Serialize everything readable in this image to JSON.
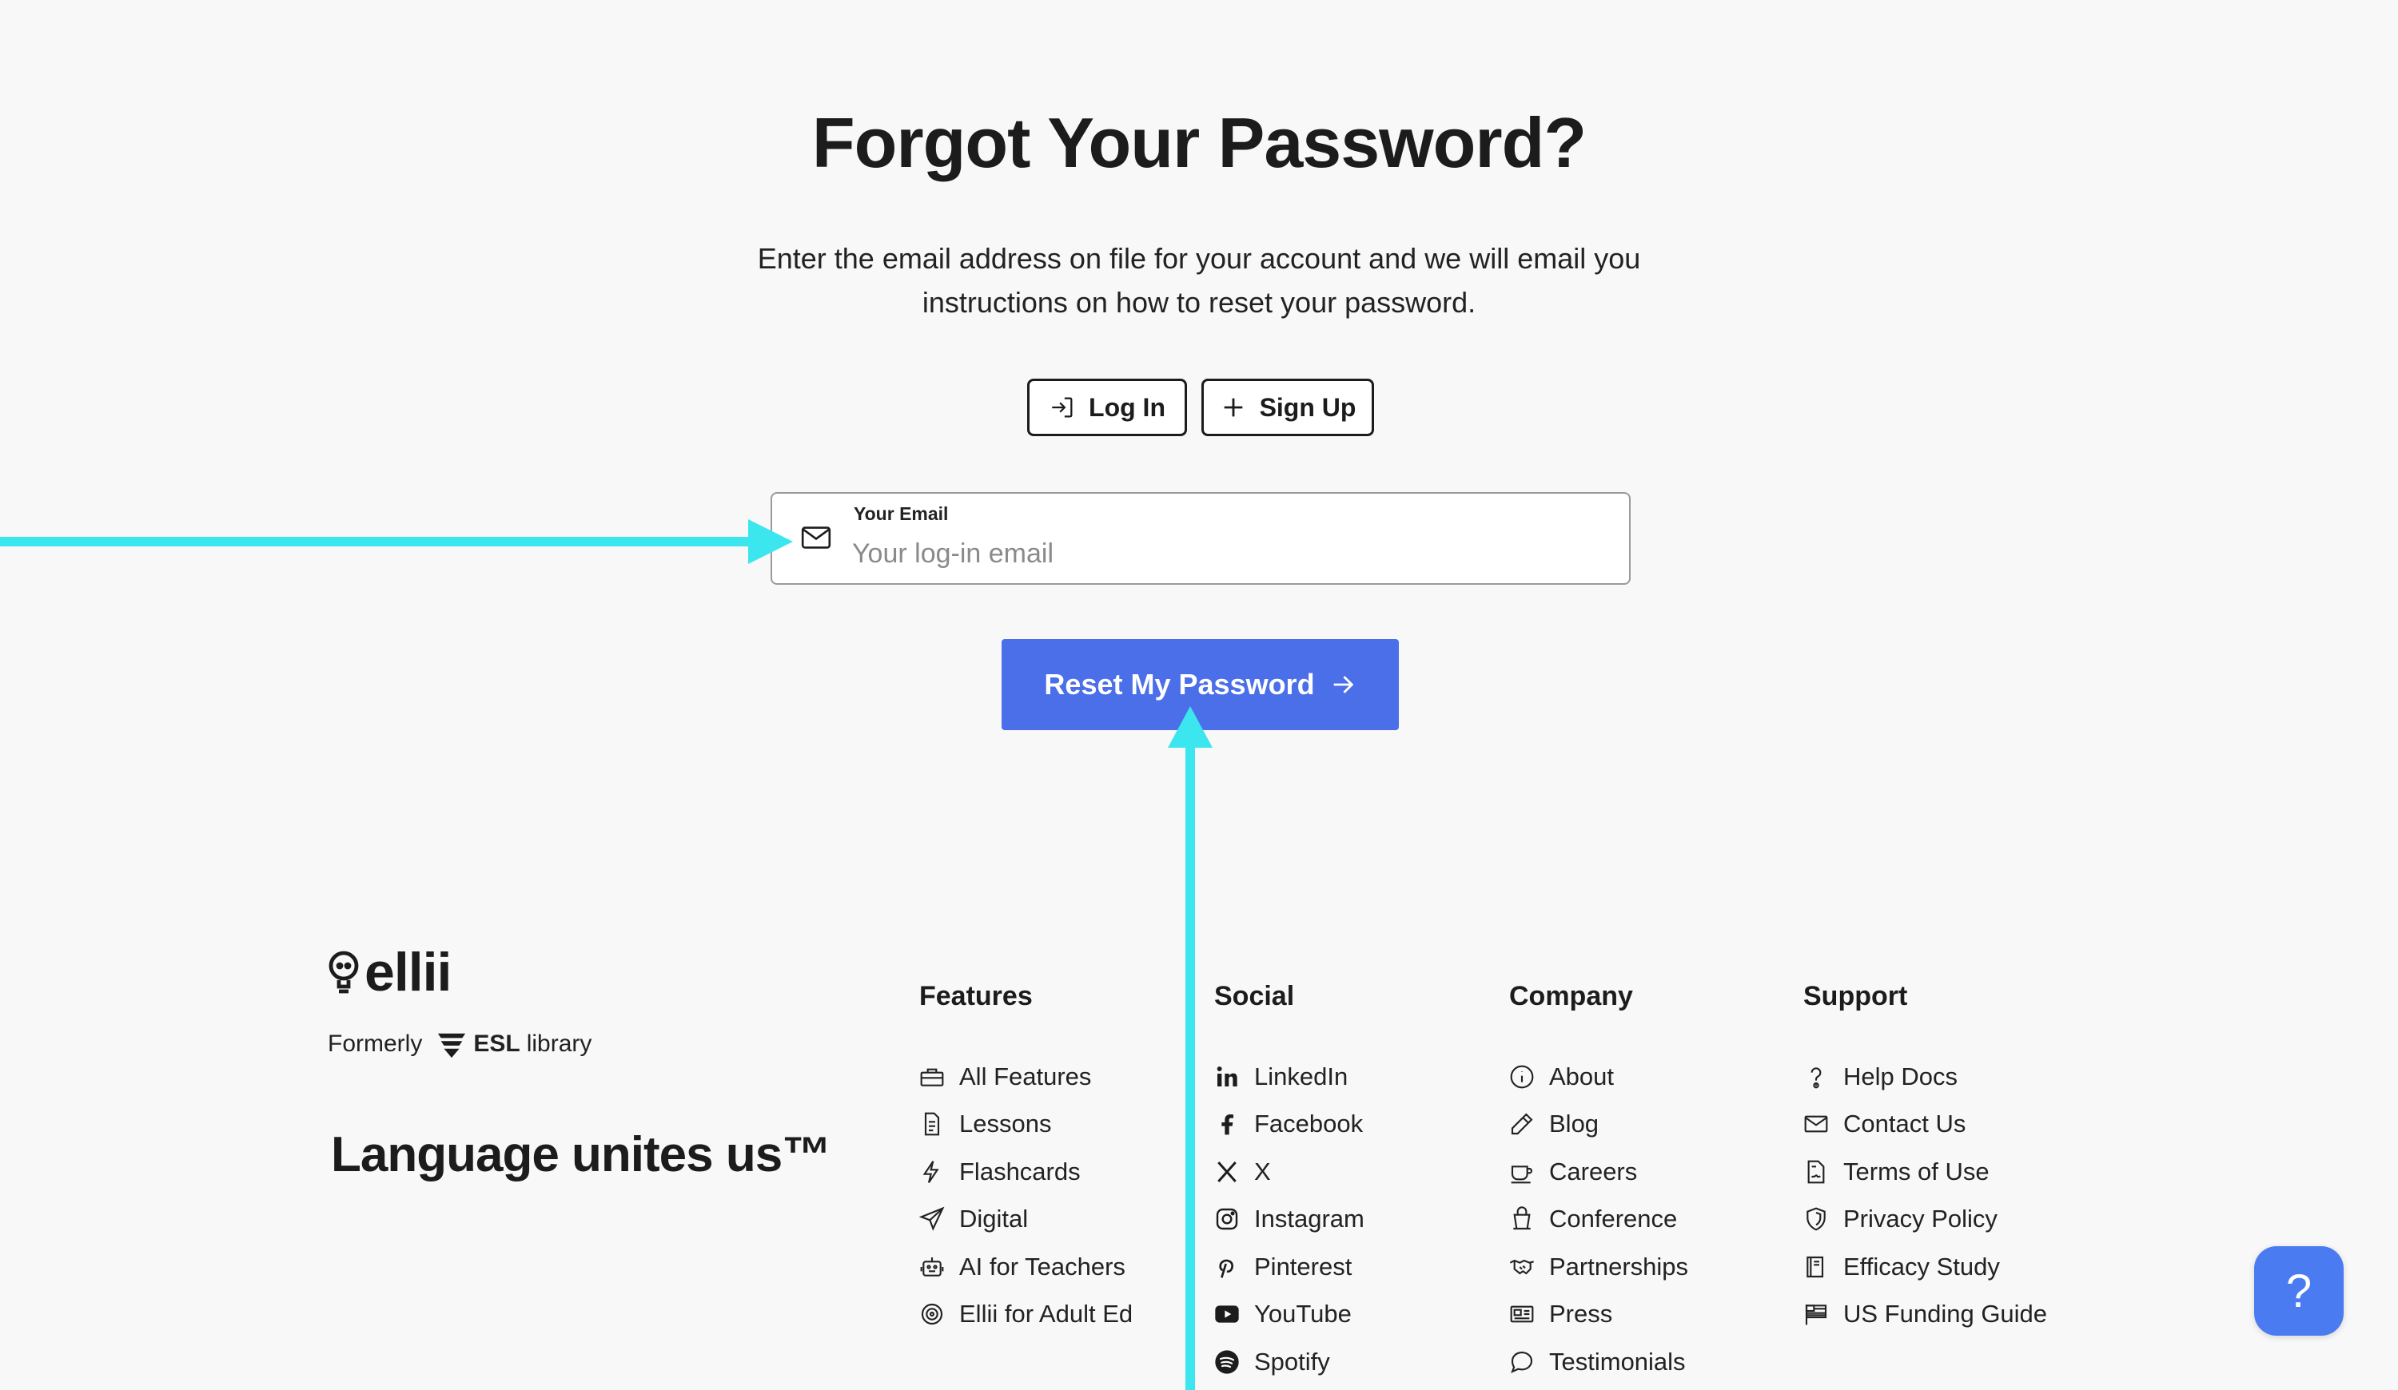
{
  "page": {
    "title": "Forgot Your Password?",
    "subtitle": "Enter the email address on file for your account and we will email you instructions on how to reset your password."
  },
  "auth_buttons": {
    "login_label": "Log In",
    "signup_label": "Sign Up"
  },
  "email_field": {
    "label": "Your Email",
    "placeholder": "Your log-in email",
    "value": ""
  },
  "reset_button": {
    "label": "Reset My Password"
  },
  "footer": {
    "brand": {
      "logo_text": "ellii",
      "formerly_label": "Formerly",
      "esl_bold": "ESL",
      "esl_light": "library",
      "tagline": "Language unites us™"
    },
    "columns": [
      {
        "heading": "Features",
        "items": [
          {
            "label": "All Features",
            "icon": "toolbox-icon"
          },
          {
            "label": "Lessons",
            "icon": "document-icon"
          },
          {
            "label": "Flashcards",
            "icon": "lightning-icon"
          },
          {
            "label": "Digital",
            "icon": "paper-plane-icon"
          },
          {
            "label": "AI for Teachers",
            "icon": "robot-icon"
          },
          {
            "label": "Ellii for Adult Ed",
            "icon": "target-icon"
          }
        ]
      },
      {
        "heading": "Social",
        "items": [
          {
            "label": "LinkedIn",
            "icon": "linkedin-icon"
          },
          {
            "label": "Facebook",
            "icon": "facebook-icon"
          },
          {
            "label": "X",
            "icon": "x-icon"
          },
          {
            "label": "Instagram",
            "icon": "instagram-icon"
          },
          {
            "label": "Pinterest",
            "icon": "pinterest-icon"
          },
          {
            "label": "YouTube",
            "icon": "youtube-icon"
          },
          {
            "label": "Spotify",
            "icon": "spotify-icon"
          }
        ]
      },
      {
        "heading": "Company",
        "items": [
          {
            "label": "About",
            "icon": "info-icon"
          },
          {
            "label": "Blog",
            "icon": "pencil-icon"
          },
          {
            "label": "Careers",
            "icon": "coffee-icon"
          },
          {
            "label": "Conference",
            "icon": "podium-icon"
          },
          {
            "label": "Partnerships",
            "icon": "handshake-icon"
          },
          {
            "label": "Press",
            "icon": "newspaper-icon"
          },
          {
            "label": "Testimonials",
            "icon": "speech-bubble-icon"
          }
        ]
      },
      {
        "heading": "Support",
        "items": [
          {
            "label": "Help Docs",
            "icon": "question-icon"
          },
          {
            "label": "Contact Us",
            "icon": "envelope-icon"
          },
          {
            "label": "Terms of Use",
            "icon": "file-contract-icon"
          },
          {
            "label": "Privacy Policy",
            "icon": "shield-icon"
          },
          {
            "label": "Efficacy Study",
            "icon": "book-icon"
          },
          {
            "label": "US Funding Guide",
            "icon": "flag-icon"
          }
        ]
      }
    ]
  },
  "help_widget": {
    "label": "?"
  },
  "colors": {
    "accent": "#4a6fe8",
    "annotation_arrow": "#3ce6ee",
    "background": "#f8f8f8"
  }
}
